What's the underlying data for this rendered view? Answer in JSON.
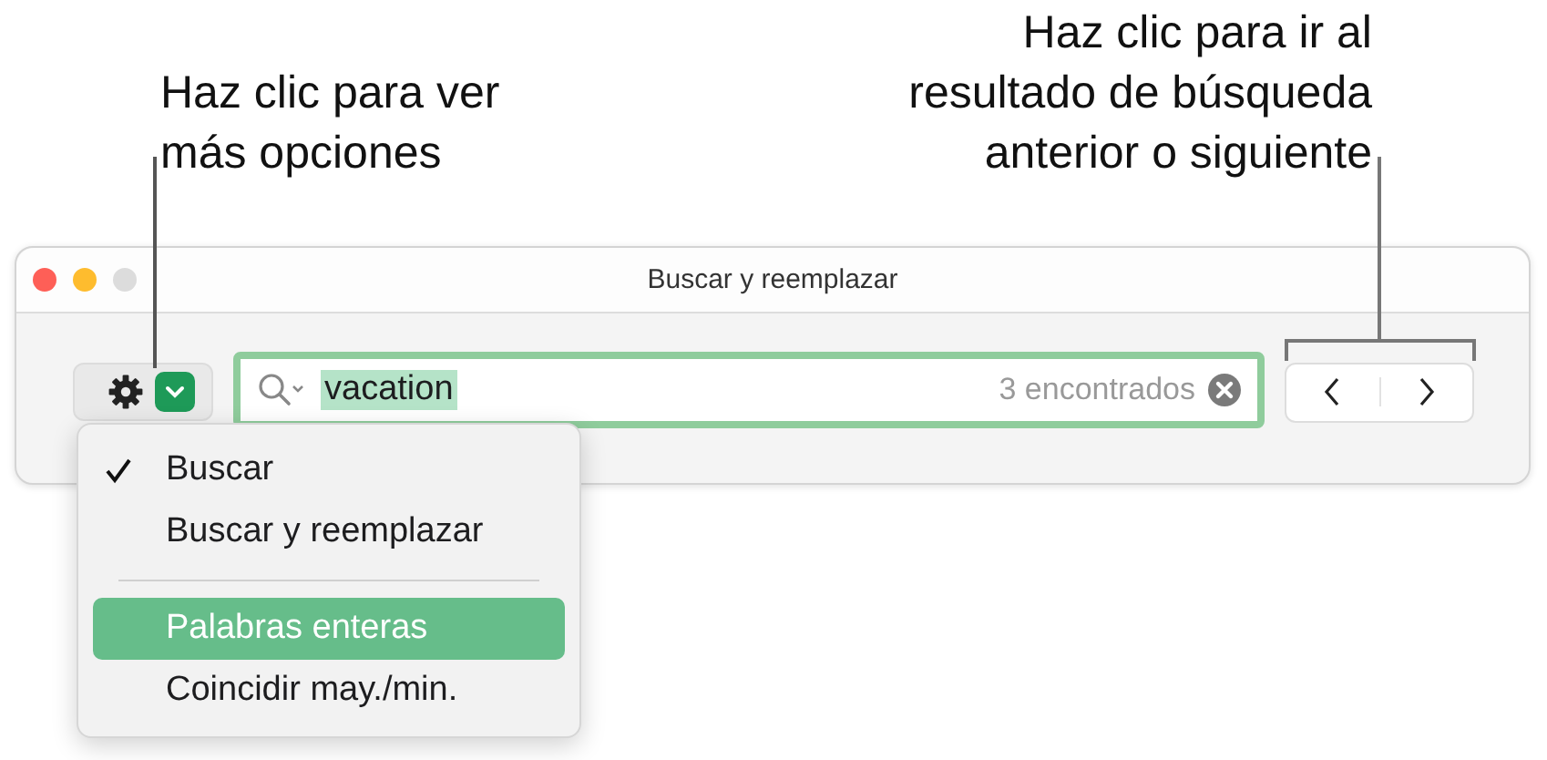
{
  "callouts": [
    {
      "kind": "left",
      "text": "Haz clic para ver más opciones"
    },
    {
      "kind": "right",
      "text": "Haz clic para ir al resultado de búsqueda anterior o siguiente"
    }
  ],
  "window": {
    "title": "Buscar y reemplazar"
  },
  "search": {
    "value": "vacation",
    "value_selected": true,
    "match_count": "3 encontrados"
  },
  "menu": {
    "items": [
      {
        "kind": "item",
        "label": "Buscar",
        "checked": true,
        "selected": false
      },
      {
        "kind": "item",
        "label": "Buscar y reemplazar",
        "checked": false,
        "selected": false
      },
      {
        "kind": "separator"
      },
      {
        "kind": "item",
        "label": "Palabras enteras",
        "checked": false,
        "selected": true
      },
      {
        "kind": "item",
        "label": "Coincidir may./min.",
        "checked": false,
        "selected": false
      }
    ]
  }
}
